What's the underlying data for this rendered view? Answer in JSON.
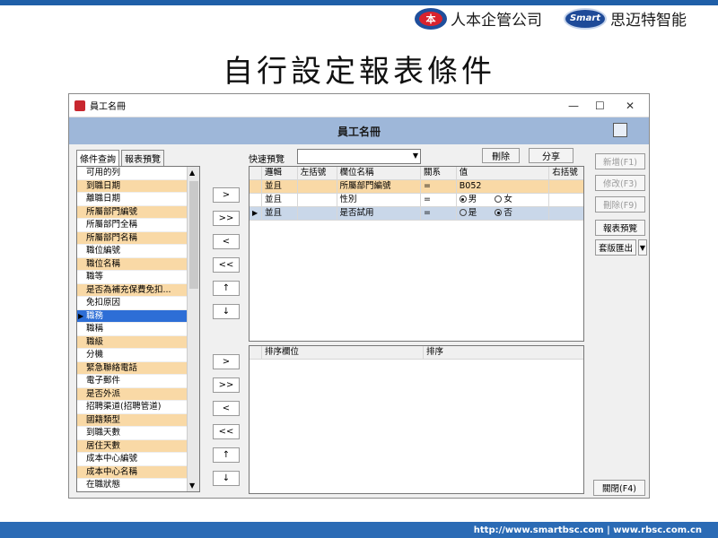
{
  "header": {
    "logo1_mark": "本",
    "logo1_text": "人本企管公司",
    "logo2_mark": "Smart",
    "logo2_text": "思迈特智能"
  },
  "slide_title": "自行設定報表條件",
  "window": {
    "title": "員工名冊",
    "banner_title": "員工名冊",
    "controls": {
      "min": "—",
      "max": "☐",
      "close": "✕"
    }
  },
  "tabs": [
    {
      "label": "條件查詢"
    },
    {
      "label": "報表預覽"
    }
  ],
  "quick": {
    "label": "快速預覽",
    "value": "",
    "arrow": "▼"
  },
  "toolbar": {
    "delete": "刪除",
    "share": "分享"
  },
  "columns_list": {
    "items": [
      {
        "label": "可用的列",
        "hl": false
      },
      {
        "label": "到職日期",
        "hl": true
      },
      {
        "label": "離職日期",
        "hl": false
      },
      {
        "label": "所屬部門編號",
        "hl": true
      },
      {
        "label": "所屬部門全稱",
        "hl": false
      },
      {
        "label": "所屬部門名稱",
        "hl": true
      },
      {
        "label": "職位編號",
        "hl": false
      },
      {
        "label": "職位名稱",
        "hl": true
      },
      {
        "label": "職等",
        "hl": false
      },
      {
        "label": "是否為補充保費免扣...",
        "hl": true
      },
      {
        "label": "免扣原因",
        "hl": false
      },
      {
        "label": "職務",
        "hl": false,
        "sel": true
      },
      {
        "label": "職稱",
        "hl": false
      },
      {
        "label": "職級",
        "hl": true
      },
      {
        "label": "分機",
        "hl": false
      },
      {
        "label": "緊急聯絡電話",
        "hl": true
      },
      {
        "label": "電子郵件",
        "hl": false
      },
      {
        "label": "是否外派",
        "hl": true
      },
      {
        "label": "招聘渠道(招聘管道)",
        "hl": false
      },
      {
        "label": "國籍類型",
        "hl": true
      },
      {
        "label": "到職天數",
        "hl": false
      },
      {
        "label": "居住天數",
        "hl": true
      },
      {
        "label": "成本中心編號",
        "hl": false
      },
      {
        "label": "成本中心名稱",
        "hl": true
      },
      {
        "label": "在職狀態",
        "hl": false
      }
    ]
  },
  "arrows1": [
    ">",
    ">>",
    "<",
    "<<",
    "↑",
    "↓"
  ],
  "arrows2": [
    ">",
    ">>",
    "<",
    "<<",
    "↑",
    "↓"
  ],
  "condition_grid": {
    "headers": [
      "邏輯",
      "左括號",
      "欄位名稱",
      "關系",
      "值",
      "右括號"
    ],
    "rows": [
      {
        "logic": "並且",
        "lp": "",
        "field": "所屬部門編號",
        "rel": "=",
        "value": "B052",
        "rp": ""
      },
      {
        "logic": "並且",
        "lp": "",
        "field": "性別",
        "rel": "=",
        "opt1": "男",
        "opt2": "女",
        "rp": ""
      },
      {
        "logic": "並且",
        "lp": "",
        "field": "是否試用",
        "rel": "=",
        "opt1": "是",
        "opt2": "否",
        "rp": ""
      }
    ]
  },
  "sort_grid": {
    "headers": [
      "排序欄位",
      "排序"
    ]
  },
  "right_buttons": {
    "new": "新增(F1)",
    "edit": "修改(F3)",
    "del": "刪除(F9)",
    "preview": "報表預覽",
    "export": "套版匯出",
    "export_arrow": "▼",
    "close": "關閉(F4)"
  },
  "footer": "http://www.smartbsc.com  |  www.rbsc.com.cn"
}
